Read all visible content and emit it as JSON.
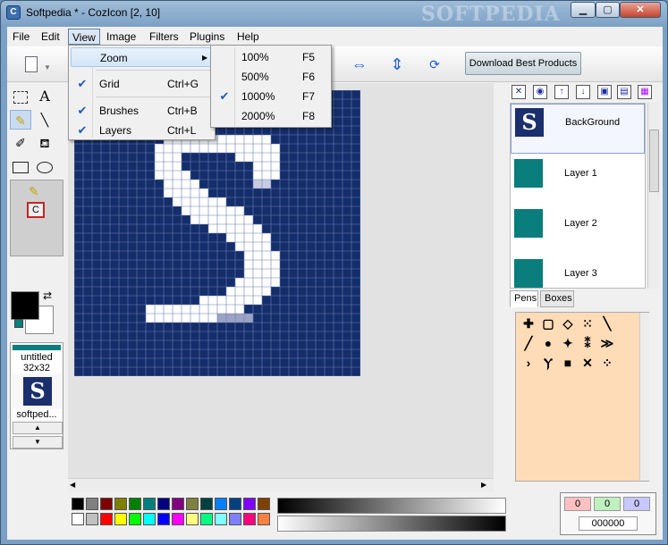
{
  "window": {
    "title": "Softpedia * - CozIcon [2, 10]",
    "watermark": "SOFTPEDIA"
  },
  "menubar": {
    "items": [
      "File",
      "Edit",
      "View",
      "Image",
      "Filters",
      "Plugins",
      "Help"
    ]
  },
  "view_menu": {
    "zoom": "Zoom",
    "grid": "Grid",
    "grid_key": "Ctrl+G",
    "brushes": "Brushes",
    "brushes_key": "Ctrl+B",
    "layers": "Layers",
    "layers_key": "Ctrl+L"
  },
  "zoom_menu": {
    "items": [
      {
        "label": "100%",
        "key": "F5",
        "checked": false
      },
      {
        "label": "500%",
        "key": "F6",
        "checked": false
      },
      {
        "label": "1000%",
        "key": "F7",
        "checked": true
      },
      {
        "label": "2000%",
        "key": "F8",
        "checked": false
      }
    ]
  },
  "toolbar": {
    "download_label": "Download Best Products"
  },
  "tools": {
    "text_glyph": "A",
    "option_letter": "C"
  },
  "documents": [
    {
      "name": "untitled",
      "size": "32x32"
    },
    {
      "name": "softped...",
      "thumb": "S"
    }
  ],
  "layers": [
    {
      "name": "BackGround",
      "thumb": "S",
      "selected": true
    },
    {
      "name": "Layer 1",
      "selected": false
    },
    {
      "name": "Layer 2",
      "selected": false
    },
    {
      "name": "Layer 3",
      "selected": false
    }
  ],
  "tabs": {
    "pens": "Pens",
    "boxes": "Boxes"
  },
  "color": {
    "r": "0",
    "g": "0",
    "b": "0",
    "hex": "000000",
    "fg": "#000000",
    "bg": "#ffffff"
  },
  "palette": {
    "row1": [
      "#000000",
      "#808080",
      "#800000",
      "#808000",
      "#008000",
      "#008080",
      "#000080",
      "#800080",
      "#808040",
      "#004040",
      "#0080ff",
      "#004080",
      "#8000ff",
      "#804000"
    ],
    "row2": [
      "#ffffff",
      "#c0c0c0",
      "#ff0000",
      "#ffff00",
      "#00ff00",
      "#00ffff",
      "#0000ff",
      "#ff00ff",
      "#ffff80",
      "#00ff80",
      "#80ffff",
      "#8080ff",
      "#ff0080",
      "#ff8040"
    ]
  },
  "canvas": {
    "bg_color": "#142d6b",
    "grid_size": 32
  }
}
